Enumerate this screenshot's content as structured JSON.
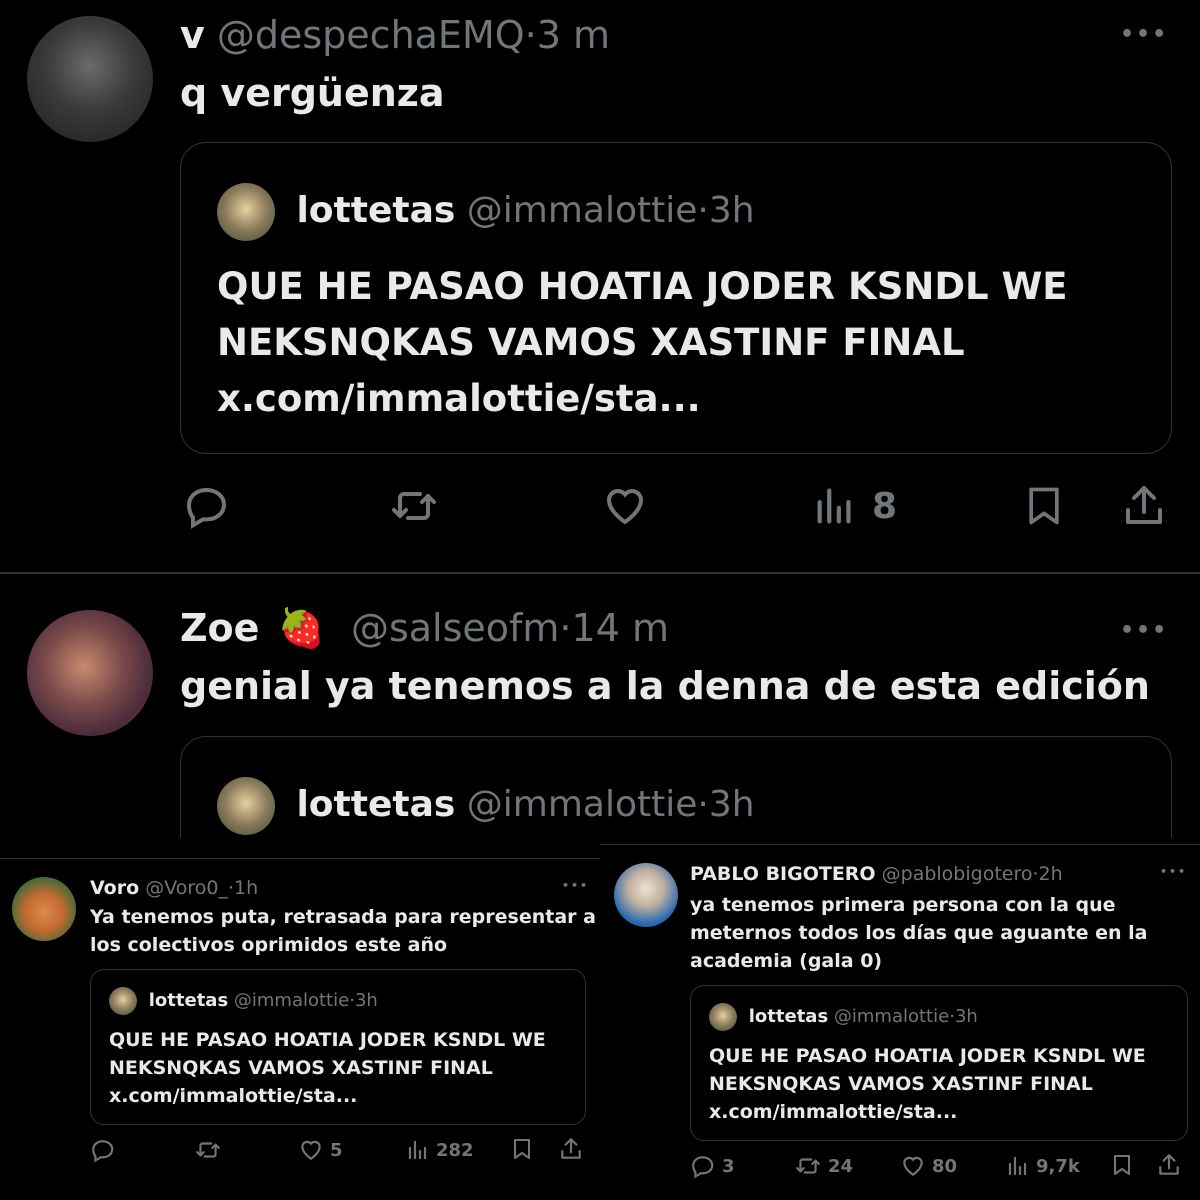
{
  "tweet1": {
    "name": "v",
    "handle": "@despechaEMQ",
    "dot": "·",
    "time": "3 m",
    "more": "•••",
    "text": "q vergüenza",
    "quote": {
      "name": "lottetas",
      "handle": "@immalottie",
      "dot": "·",
      "time": "3h",
      "line1": "QUE HE PASAO HOATIA JODER KSNDL WE",
      "line2": "NEKSNQKAS VAMOS XASTINF FINAL",
      "link": "x.com/immalottie/sta..."
    },
    "views": "8"
  },
  "tweet2": {
    "name": "Zoe",
    "emoji": "🍓",
    "handle": "@salseofm",
    "dot": "·",
    "time": "14 m",
    "more": "•••",
    "text": "genial ya tenemos a la denna de esta edición",
    "quote": {
      "name": "lottetas",
      "handle": "@immalottie",
      "dot": "·",
      "time": "3h"
    }
  },
  "tweet3": {
    "name": "Voro",
    "handle": "@Voro0_",
    "dot": "·",
    "time": "1h",
    "more": "•••",
    "line1": "Ya tenemos puta, retrasada para representar a",
    "line2": "los colectivos oprimidos este año",
    "quote": {
      "name": "lottetas",
      "handle": "@immalottie",
      "dot": "·",
      "time": "3h",
      "line1": "QUE HE PASAO HOATIA JODER KSNDL WE",
      "line2": "NEKSNQKAS VAMOS XASTINF FINAL",
      "link": "x.com/immalottie/sta..."
    },
    "likes": "5",
    "views": "282"
  },
  "tweet4": {
    "name": "PABLO BIGOTERO",
    "handle": "@pablobigotero",
    "dot": "·",
    "time": "2h",
    "more": "•••",
    "line1": "ya tenemos primera persona con la que",
    "line2": "meternos todos los días que aguante en la",
    "line3": "academia (gala 0)",
    "quote": {
      "name": "lottetas",
      "handle": "@immalottie",
      "dot": "·",
      "time": "3h",
      "line1": "QUE HE PASAO HOATIA JODER KSNDL WE",
      "line2": "NEKSNQKAS VAMOS XASTINF FINAL",
      "link": "x.com/immalottie/sta..."
    },
    "replies": "3",
    "reposts": "24",
    "likes": "80",
    "views": "9,7k"
  },
  "colors": {
    "background": "#000000",
    "text": "#e7e9ea",
    "muted": "#71767b",
    "border": "#2f3336"
  }
}
